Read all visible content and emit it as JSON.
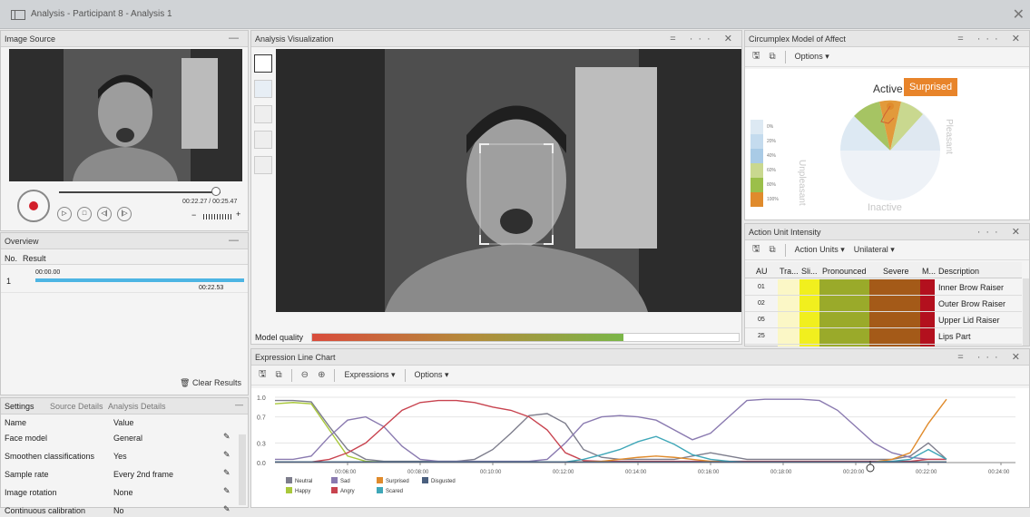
{
  "window": {
    "title": "Analysis - Participant 8 - Analysis 1"
  },
  "image_source": {
    "title": "Image Source",
    "time": "00:22.27 / 00:25.47",
    "minus": "−",
    "plus": "+"
  },
  "overview": {
    "title": "Overview",
    "col_no": "No.",
    "col_result": "Result",
    "row_no": "1",
    "row_start": "00:00.00",
    "row_end": "00:22.53",
    "clear": "Clear Results"
  },
  "settings": {
    "tabs": [
      "Settings",
      "Source Details",
      "Analysis Details"
    ],
    "col_name": "Name",
    "col_value": "Value",
    "rows": [
      {
        "name": "Face model",
        "value": "General"
      },
      {
        "name": "Smoothen classifications",
        "value": "Yes"
      },
      {
        "name": "Sample rate",
        "value": "Every 2nd frame"
      },
      {
        "name": "Image rotation",
        "value": "None"
      },
      {
        "name": "Continuous calibration",
        "value": "No"
      }
    ]
  },
  "analysis": {
    "title": "Analysis Visualization",
    "model_quality": "Model quality",
    "model_quality_value": 0.73
  },
  "circumplex": {
    "title": "Circumplex Model of Affect",
    "options": "Options",
    "active": "Active",
    "inactive": "Inactive",
    "unpleasant": "Unpleasant",
    "pleasant": "Pleasant",
    "tooltip": "Surprised",
    "legend": [
      "0%",
      "20%",
      "40%",
      "60%",
      "80%",
      "100%"
    ],
    "legend_colors": [
      "#dde9f3",
      "#c4dbee",
      "#a9cbe6",
      "#c9d88f",
      "#9bbf4a",
      "#e08b2c"
    ]
  },
  "action_units": {
    "title": "Action Unit Intensity",
    "menu1": "Action Units",
    "menu2": "Unilateral",
    "headers": [
      "AU",
      "Tra...",
      "Sli...",
      "Pronounced",
      "Severe",
      "M...",
      "Description"
    ],
    "rows": [
      {
        "au": "01",
        "desc": "Inner Brow Raiser"
      },
      {
        "au": "02",
        "desc": "Outer Brow Raiser"
      },
      {
        "au": "05",
        "desc": "Upper Lid Raiser"
      },
      {
        "au": "25",
        "desc": "Lips Part"
      }
    ]
  },
  "expression": {
    "title": "Expression Line Chart",
    "menu1": "Expressions",
    "menu2": "Options"
  },
  "chart_data": {
    "type": "line",
    "yticks": [
      "1.0",
      "0.7",
      "0.3",
      "0.0"
    ],
    "xticks": [
      "00:06:00",
      "00:08:00",
      "00:10:00",
      "00:12:00",
      "00:14:00",
      "00:16:00",
      "00:18:00",
      "00:20:00",
      "00:22:00",
      "00:24:00"
    ],
    "x": [
      4.0,
      4.5,
      5.0,
      5.5,
      6.0,
      6.5,
      7.0,
      7.5,
      8.0,
      8.5,
      9.0,
      9.5,
      10.0,
      10.5,
      11.0,
      11.5,
      12.0,
      12.5,
      13.0,
      13.5,
      14.0,
      14.5,
      15.0,
      15.5,
      16.0,
      16.5,
      17.0,
      17.5,
      18.0,
      18.5,
      19.0,
      19.5,
      20.0,
      20.5,
      21.0,
      21.5,
      22.0,
      22.5
    ],
    "series": [
      {
        "name": "Neutral",
        "color": "#7d7d8c",
        "values": [
          0.95,
          0.95,
          0.93,
          0.55,
          0.2,
          0.05,
          0.02,
          0.02,
          0.02,
          0.02,
          0.02,
          0.05,
          0.2,
          0.45,
          0.72,
          0.75,
          0.6,
          0.2,
          0.08,
          0.05,
          0.05,
          0.05,
          0.05,
          0.1,
          0.15,
          0.1,
          0.05,
          0.05,
          0.05,
          0.05,
          0.05,
          0.05,
          0.05,
          0.05,
          0.05,
          0.1,
          0.3,
          0.05
        ]
      },
      {
        "name": "Happy",
        "color": "#a9c83b",
        "values": [
          0.9,
          0.92,
          0.9,
          0.5,
          0.1,
          0.02,
          0.01,
          0.01,
          0.01,
          0.01,
          0.01,
          0.01,
          0.01,
          0.01,
          0.01,
          0.01,
          0.01,
          0.01,
          0.01,
          0.01,
          0.01,
          0.01,
          0.01,
          0.01,
          0.01,
          0.01,
          0.01,
          0.01,
          0.01,
          0.01,
          0.01,
          0.01,
          0.01,
          0.01,
          0.01,
          0.01,
          0.01,
          0.01
        ]
      },
      {
        "name": "Sad",
        "color": "#8a7ab0",
        "values": [
          0.05,
          0.05,
          0.1,
          0.4,
          0.65,
          0.7,
          0.55,
          0.25,
          0.05,
          0.02,
          0.02,
          0.02,
          0.02,
          0.02,
          0.02,
          0.05,
          0.3,
          0.6,
          0.7,
          0.72,
          0.7,
          0.65,
          0.5,
          0.35,
          0.45,
          0.7,
          0.95,
          0.97,
          0.97,
          0.97,
          0.95,
          0.8,
          0.55,
          0.3,
          0.15,
          0.08,
          0.05,
          0.05
        ]
      },
      {
        "name": "Angry",
        "color": "#c8434f",
        "values": [
          0.01,
          0.01,
          0.01,
          0.05,
          0.15,
          0.3,
          0.55,
          0.8,
          0.92,
          0.95,
          0.95,
          0.92,
          0.85,
          0.8,
          0.7,
          0.5,
          0.15,
          0.03,
          0.02,
          0.02,
          0.02,
          0.02,
          0.02,
          0.02,
          0.02,
          0.02,
          0.02,
          0.02,
          0.02,
          0.02,
          0.02,
          0.02,
          0.02,
          0.02,
          0.02,
          0.02,
          0.05,
          0.05
        ]
      },
      {
        "name": "Surprised",
        "color": "#e08b2c",
        "values": [
          0.01,
          0.01,
          0.01,
          0.01,
          0.01,
          0.01,
          0.01,
          0.01,
          0.01,
          0.01,
          0.01,
          0.01,
          0.01,
          0.01,
          0.01,
          0.01,
          0.01,
          0.01,
          0.02,
          0.05,
          0.08,
          0.1,
          0.08,
          0.05,
          0.02,
          0.01,
          0.01,
          0.01,
          0.01,
          0.01,
          0.01,
          0.01,
          0.01,
          0.01,
          0.05,
          0.15,
          0.6,
          0.97
        ]
      },
      {
        "name": "Scared",
        "color": "#3fa7b8",
        "values": [
          0.01,
          0.01,
          0.01,
          0.01,
          0.01,
          0.01,
          0.01,
          0.01,
          0.01,
          0.01,
          0.01,
          0.01,
          0.01,
          0.01,
          0.01,
          0.01,
          0.01,
          0.05,
          0.12,
          0.2,
          0.32,
          0.4,
          0.28,
          0.12,
          0.05,
          0.02,
          0.01,
          0.01,
          0.01,
          0.01,
          0.01,
          0.01,
          0.01,
          0.01,
          0.02,
          0.05,
          0.2,
          0.05
        ]
      },
      {
        "name": "Disgusted",
        "color": "#4a5f7e",
        "values": [
          0.01,
          0.01,
          0.01,
          0.01,
          0.01,
          0.01,
          0.01,
          0.01,
          0.01,
          0.01,
          0.01,
          0.01,
          0.01,
          0.01,
          0.01,
          0.01,
          0.01,
          0.01,
          0.01,
          0.01,
          0.01,
          0.01,
          0.01,
          0.01,
          0.01,
          0.01,
          0.01,
          0.01,
          0.01,
          0.01,
          0.01,
          0.01,
          0.01,
          0.01,
          0.01,
          0.01,
          0.01,
          0.01
        ]
      }
    ],
    "legend_order": [
      "Neutral",
      "Sad",
      "Surprised",
      "Disgusted",
      "Happy",
      "Angry",
      "Scared"
    ],
    "cursor_x": 20.4,
    "ylim": [
      0,
      1
    ],
    "xlim": [
      4.0,
      24.4
    ]
  }
}
